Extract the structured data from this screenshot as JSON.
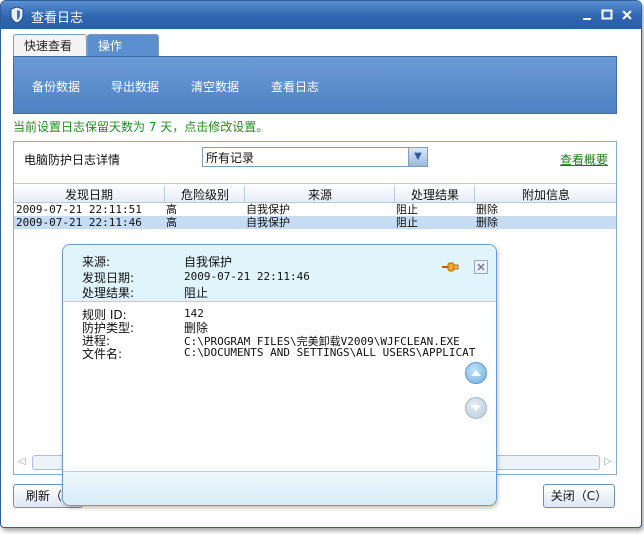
{
  "window": {
    "title": "查看日志"
  },
  "tabs": [
    {
      "label": "快速查看"
    },
    {
      "label": "操作"
    }
  ],
  "toolbar": {
    "items": [
      "备份数据",
      "导出数据",
      "清空数据",
      "查看日志"
    ]
  },
  "notice": "当前设置日志保留天数为 7 天，点击修改设置。",
  "detail": {
    "label": "电脑防护日志详情",
    "filter": {
      "value": "所有记录"
    },
    "overview_link": "查看概要"
  },
  "table": {
    "columns": [
      "发现日期",
      "危险级别",
      "来源",
      "处理结果",
      "附加信息"
    ],
    "rows": [
      {
        "date": "2009-07-21 22:11:51",
        "level": "高",
        "source": "自我保护",
        "result": "阻止",
        "extra": "删除"
      },
      {
        "date": "2009-07-21 22:11:46",
        "level": "高",
        "source": "自我保护",
        "result": "阻止",
        "extra": "删除"
      }
    ]
  },
  "popup": {
    "source_label": "来源:",
    "source_value": "自我保护",
    "date_label": "发现日期:",
    "date_value": "2009-07-21 22:11:46",
    "result_label": "处理结果:",
    "result_value": "阻止",
    "rule_label": "规则 ID:",
    "rule_value": "142",
    "type_label": "防护类型:",
    "type_value": "删除",
    "process_label": "进程:",
    "process_value": "C:\\PROGRAM FILES\\完美卸载V2009\\WJFCLEAN.EXE",
    "file_label": "文件名:",
    "file_value": "C:\\DOCUMENTS AND SETTINGS\\ALL USERS\\APPLICAT"
  },
  "buttons": {
    "refresh": "刷新（R",
    "close": "关闭（C）"
  },
  "colors": {
    "accent": "#4f82c4",
    "notice": "#1f8f1f",
    "selected_row": "#c5dcf3"
  }
}
